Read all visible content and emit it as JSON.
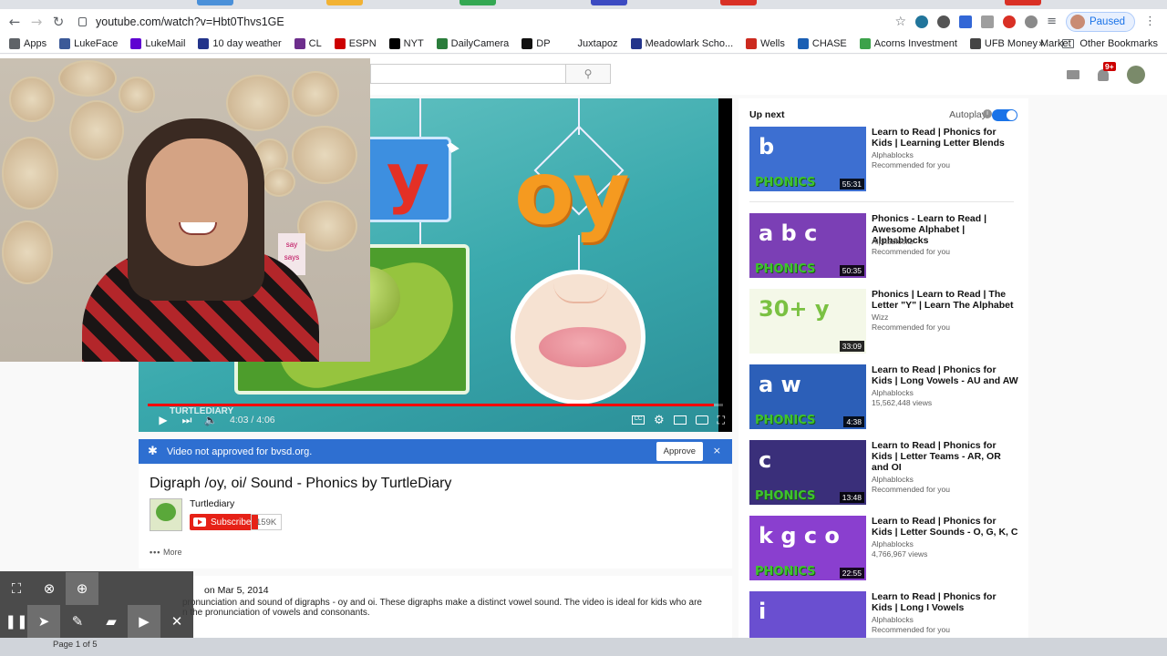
{
  "browser": {
    "url": "youtube.com/watch?v=Hbt0Thvs1GE",
    "profile_status": "Paused",
    "tab_colors": [
      "#4a90d9",
      "#f2b233",
      "#34a853",
      "#3c4bc2",
      "#d93025",
      "#d93025"
    ]
  },
  "bookmarks": {
    "items": [
      {
        "label": "Apps",
        "color": "#5f6368"
      },
      {
        "label": "LukeFace",
        "color": "#3b5998"
      },
      {
        "label": "LukeMail",
        "color": "#5f01d1"
      },
      {
        "label": "10 day weather",
        "color": "#23348b"
      },
      {
        "label": "CL",
        "color": "#6d2e8c"
      },
      {
        "label": "ESPN",
        "color": "#cc0000"
      },
      {
        "label": "NYT",
        "color": "#000000"
      },
      {
        "label": "DailyCamera",
        "color": "#2a7d3b"
      },
      {
        "label": "DP",
        "color": "#111111"
      },
      {
        "label": "Juxtapoz",
        "color": "#ffffff"
      },
      {
        "label": "Meadowlark Scho...",
        "color": "#23348b"
      },
      {
        "label": "Wells",
        "color": "#cc2a1f"
      },
      {
        "label": "CHASE",
        "color": "#1a5fb4"
      },
      {
        "label": "Acorns Investment",
        "color": "#3ca24a"
      },
      {
        "label": "UFB Money Market",
        "color": "#444444"
      }
    ],
    "overflow": "»",
    "other": "Other Bookmarks"
  },
  "youtube": {
    "search_icon": "search-icon",
    "notification_count": "9+"
  },
  "player": {
    "card_letter": "y",
    "digraph": "oy",
    "time": "4:03 / 4:06",
    "progress_fraction": 0.984,
    "watermark": "TURTLEDIARY"
  },
  "notice": {
    "text": "Video not approved for bvsd.org.",
    "approve_label": "Approve",
    "close": "×"
  },
  "video": {
    "title": "Digraph /oy, oi/ Sound - Phonics by TurtleDiary",
    "channel": "Turtlediary",
    "subscribe_label": "Subscribe",
    "subscriber_count": "159K",
    "more_label": "More",
    "published": "on Mar 5, 2014",
    "description_line1": "pronunciation and sound of digraphs - oy and oi. These digraphs make a distinct vowel sound. The video is ideal for kids who are",
    "description_line2": "n the pronunciation of vowels and consonants."
  },
  "webcam": {
    "note_line1": "say",
    "note_line2": "says"
  },
  "sidebar": {
    "up_next": "Up next",
    "autoplay_label": "Autoplay",
    "autoplay_on": true,
    "items": [
      {
        "title": "Learn to Read | Phonics for Kids | Learning Letter Blends",
        "channel": "Alphablocks",
        "meta": "Recommended for you",
        "duration": "55:31",
        "thumb_text": "b",
        "thumb_bg": "#3d6fd1"
      },
      {
        "title": "Phonics - Learn to Read | Awesome Alphabet | Alphablocks",
        "channel": "Alphablocks",
        "meta": "Recommended for you",
        "duration": "50:35",
        "thumb_text": "a b c",
        "thumb_bg": "#7b3fb5"
      },
      {
        "title": "Phonics | Learn to Read | The Letter \"Y\" | Learn The Alphabet",
        "channel": "Wizz",
        "meta": "Recommended for you",
        "duration": "33:09",
        "thumb_text": "30+ y",
        "thumb_bg": "#f4f8e8"
      },
      {
        "title": "Learn to Read | Phonics for Kids | Long Vowels - AU and AW",
        "channel": "Alphablocks",
        "meta": "15,562,448 views",
        "duration": "4:38",
        "thumb_text": "a w",
        "thumb_bg": "#2c5fb8"
      },
      {
        "title": "Learn to Read | Phonics for Kids | Letter Teams - AR, OR and OI",
        "channel": "Alphablocks",
        "meta": "Recommended for you",
        "duration": "13:48",
        "thumb_text": "c",
        "thumb_bg": "#3a2f7a"
      },
      {
        "title": "Learn to Read | Phonics for Kids | Letter Sounds - O, G, K, C",
        "channel": "Alphablocks",
        "meta": "4,766,967 views",
        "duration": "22:55",
        "thumb_text": "k g c o",
        "thumb_bg": "#8a3fcf"
      },
      {
        "title": "Learn to Read | Phonics for Kids | Long I Vowels",
        "channel": "Alphablocks",
        "meta": "Recommended for you",
        "duration": "",
        "thumb_text": "i",
        "thumb_bg": "#6a4fd0"
      }
    ]
  },
  "toolbar": {
    "buttons": [
      "screenshot-icon",
      "clear-icon",
      "zoom-icon",
      "pause-icon",
      "pointer-icon",
      "pen-icon",
      "highlighter-icon",
      "camera-icon",
      "close-icon"
    ]
  },
  "footer": {
    "page_indicator": "Page 1 of 5"
  }
}
